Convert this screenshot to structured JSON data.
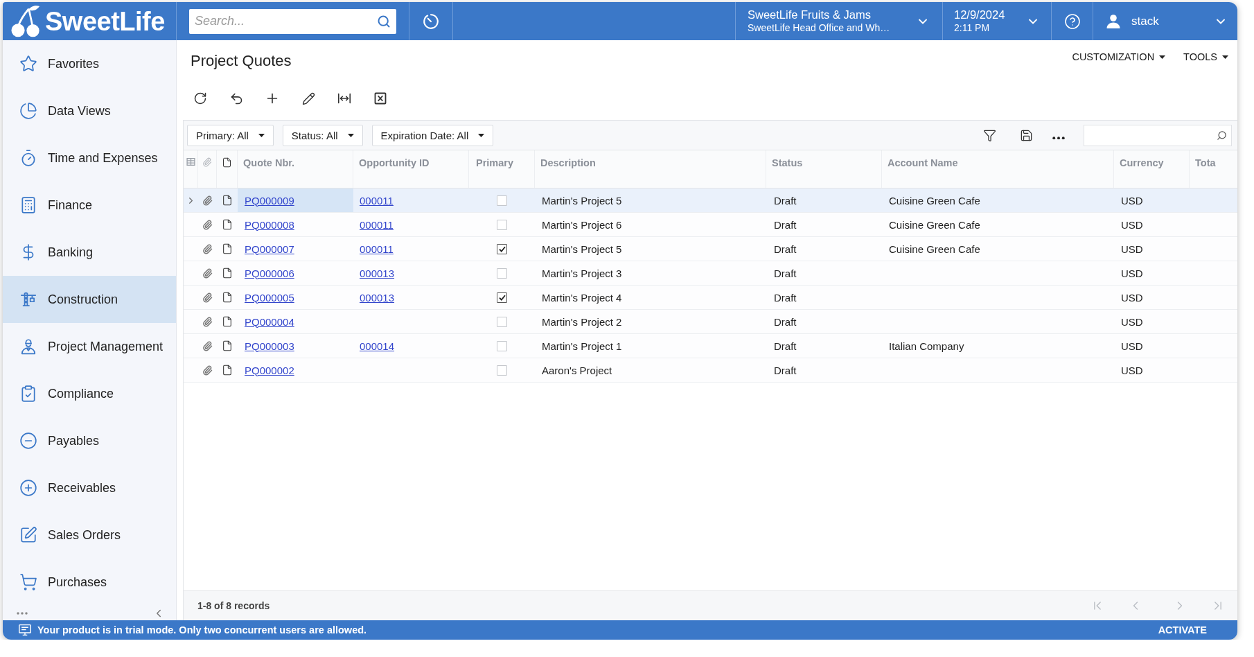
{
  "header": {
    "logo": "SweetLife",
    "search": {
      "placeholder": "Search..."
    },
    "company": {
      "name": "SweetLife Fruits & Jams",
      "branch": "SweetLife Head Office and Wh…"
    },
    "datetime": {
      "date": "12/9/2024",
      "time": "2:11 PM"
    },
    "user": {
      "name": "stack"
    }
  },
  "sidebar": {
    "items": [
      {
        "label": "Favorites",
        "selected": false
      },
      {
        "label": "Data Views",
        "selected": false
      },
      {
        "label": "Time and Expenses",
        "selected": false
      },
      {
        "label": "Finance",
        "selected": false
      },
      {
        "label": "Banking",
        "selected": false
      },
      {
        "label": "Construction",
        "selected": true
      },
      {
        "label": "Project Management",
        "selected": false
      },
      {
        "label": "Compliance",
        "selected": false
      },
      {
        "label": "Payables",
        "selected": false
      },
      {
        "label": "Receivables",
        "selected": false
      },
      {
        "label": "Sales Orders",
        "selected": false
      },
      {
        "label": "Purchases",
        "selected": false
      }
    ]
  },
  "page": {
    "title": "Project Quotes",
    "menus": [
      "CUSTOMIZATION",
      "TOOLS"
    ]
  },
  "grid": {
    "filters": [
      "Primary: All",
      "Status: All",
      "Expiration Date: All"
    ],
    "columns": [
      "Quote Nbr.",
      "Opportunity ID",
      "Primary",
      "Description",
      "Status",
      "Account Name",
      "Currency",
      "Tota"
    ],
    "rows": [
      {
        "selected": true,
        "quote_nbr": "PQ000009",
        "opportunity_id": "000011",
        "primary": false,
        "description": "Martin's Project 5",
        "status": "Draft",
        "account_name": "Cuisine Green Cafe",
        "currency": "USD"
      },
      {
        "selected": false,
        "quote_nbr": "PQ000008",
        "opportunity_id": "000011",
        "primary": false,
        "description": "Martin's Project 6",
        "status": "Draft",
        "account_name": "Cuisine Green Cafe",
        "currency": "USD"
      },
      {
        "selected": false,
        "quote_nbr": "PQ000007",
        "opportunity_id": "000011",
        "primary": true,
        "description": "Martin's Project 5",
        "status": "Draft",
        "account_name": "Cuisine Green Cafe",
        "currency": "USD"
      },
      {
        "selected": false,
        "quote_nbr": "PQ000006",
        "opportunity_id": "000013",
        "primary": false,
        "description": "Martin's Project 3",
        "status": "Draft",
        "currency": "USD"
      },
      {
        "selected": false,
        "quote_nbr": "PQ000005",
        "opportunity_id": "000013",
        "primary": true,
        "description": "Martin's Project 4",
        "status": "Draft",
        "currency": "USD"
      },
      {
        "selected": false,
        "quote_nbr": "PQ000004",
        "primary": false,
        "description": "Martin's Project 2",
        "status": "Draft",
        "currency": "USD"
      },
      {
        "selected": false,
        "quote_nbr": "PQ000003",
        "opportunity_id": "000014",
        "primary": false,
        "description": "Martin's Project 1",
        "status": "Draft",
        "account_name": "Italian Company",
        "currency": "USD"
      },
      {
        "selected": false,
        "quote_nbr": "PQ000002",
        "primary": false,
        "description": "Aaron's Project",
        "status": "Draft",
        "currency": "USD"
      }
    ],
    "records": "1-8 of 8 records"
  },
  "status_bar": {
    "message": "Your product is in trial mode. Only two concurrent users are allowed.",
    "action": "ACTIVATE"
  }
}
